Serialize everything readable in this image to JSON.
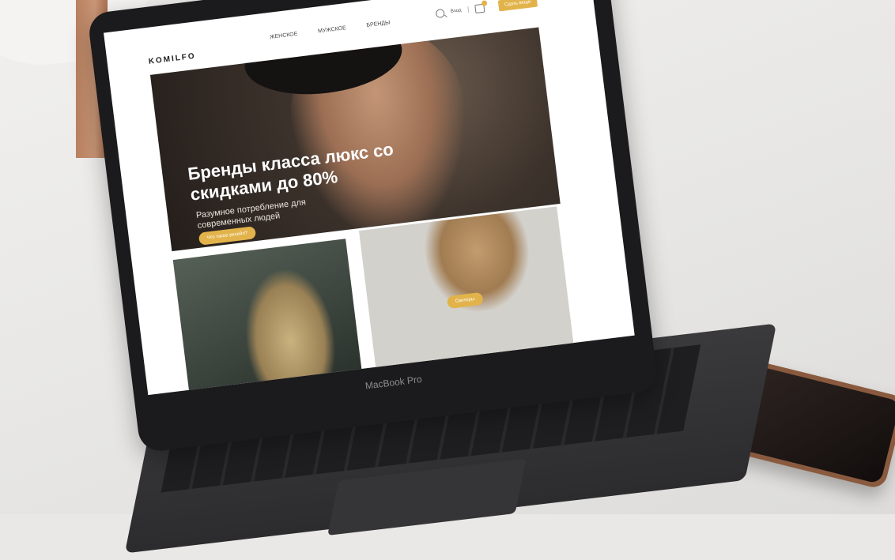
{
  "site": {
    "logo": "KOMILFO",
    "nav": [
      "ЖЕНСКОЕ",
      "МУЖСКОЕ",
      "БРЕНДЫ"
    ],
    "login": "Вход",
    "sell_button": "Сдать вещи"
  },
  "hero": {
    "title": "Бренды класса люкс со скидками до 80%",
    "subtitle": "Разумное потребление для современных людей",
    "cta": "Что такое ресейл?"
  },
  "cards": {
    "second_button": "Свитеры"
  },
  "device": {
    "label": "MacBook Pro"
  },
  "colors": {
    "accent": "#e2b34a",
    "laptop": "#1b1b1d"
  },
  "icons": [
    "search-icon",
    "cart-icon"
  ]
}
